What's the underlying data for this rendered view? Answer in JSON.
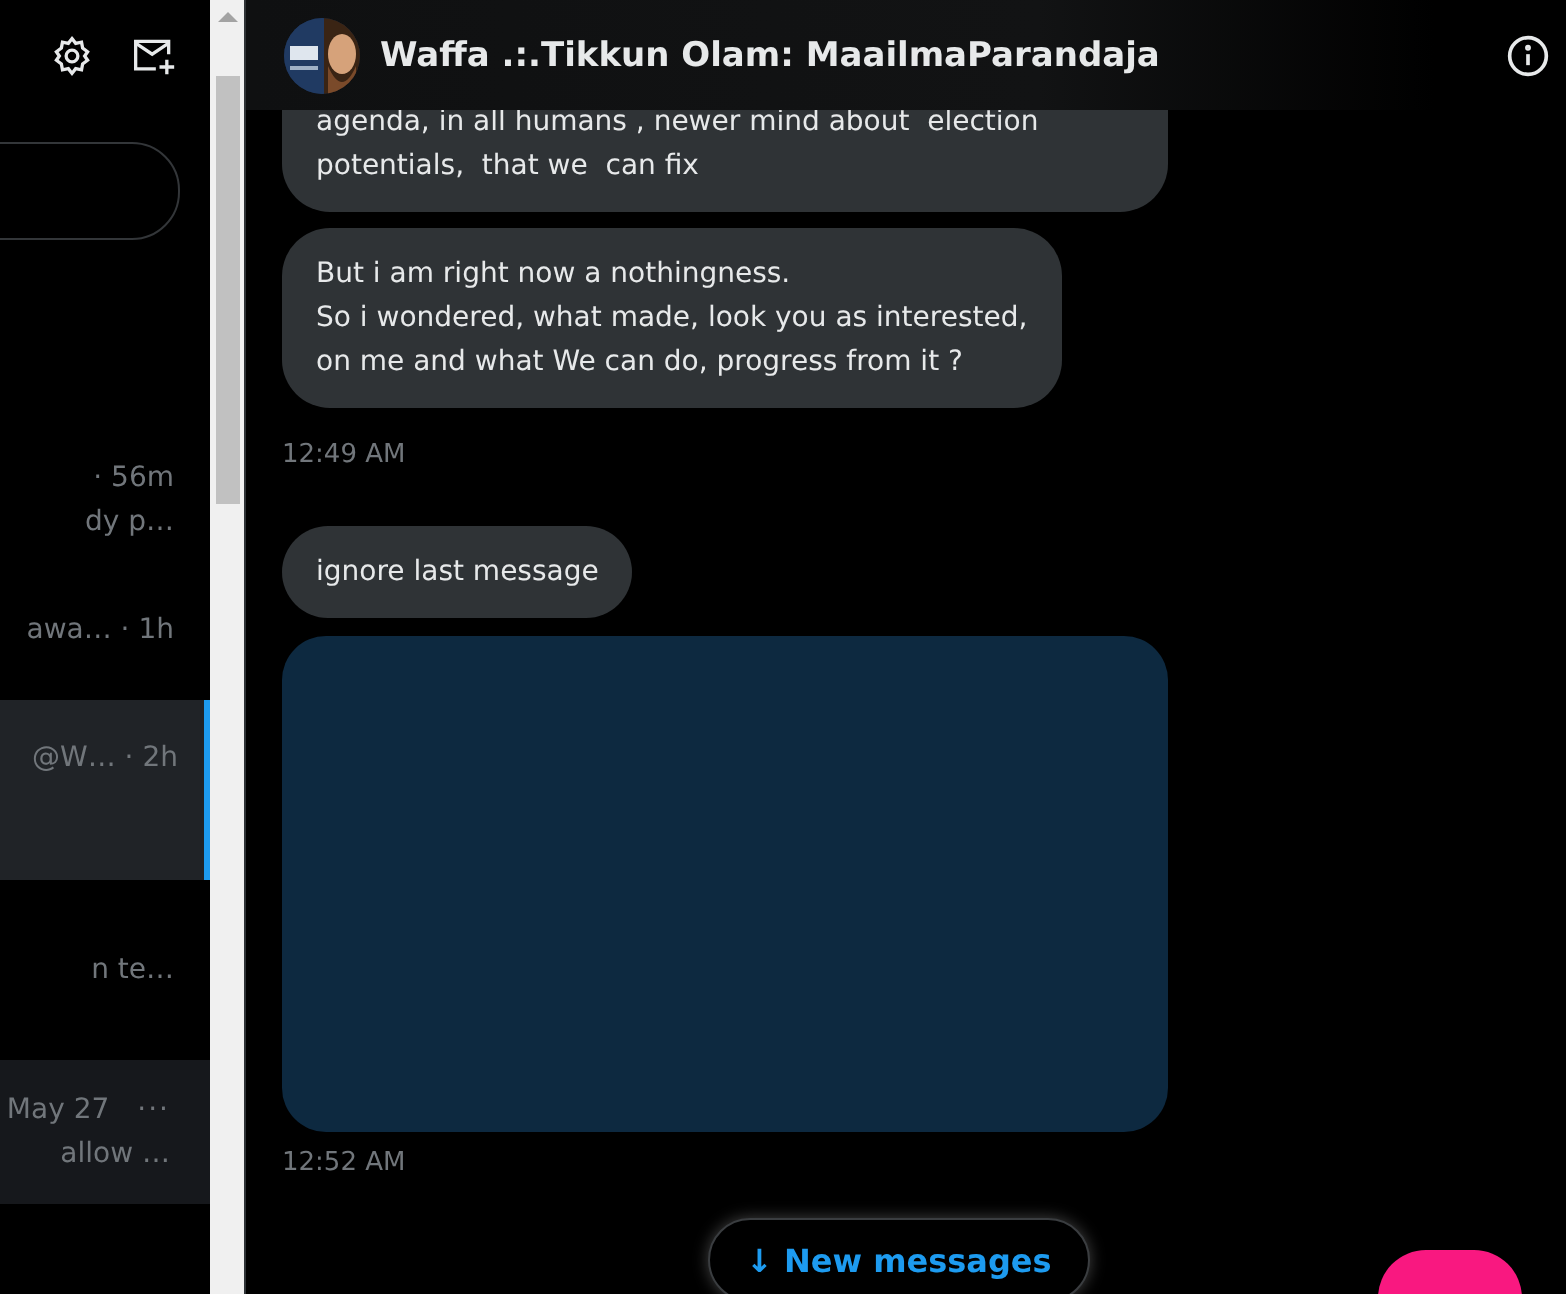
{
  "sidebar": {
    "conversations": [
      {
        "line_1": "· 56m",
        "line_2": "dy p…",
        "selected": false
      },
      {
        "line_1": "awa… · 1h",
        "selected": false
      },
      {
        "line_1": "@W… · 2h",
        "selected": true
      },
      {
        "line_2": "n te…",
        "selected": false
      },
      {
        "line_1": "May 27",
        "line_2": "allow …",
        "selected": false,
        "more": "···"
      }
    ]
  },
  "chat": {
    "title": "Waffa .:.Tikkun Olam: MaailmaParandaja",
    "messages": [
      {
        "kind": "text",
        "text": "agenda, in all humans , newer mind about  election\npotentials,  that we  can fix"
      },
      {
        "kind": "text",
        "text": "But i am right now a nothingness.\nSo i wondered, what made, look you as interested,\non me and what We can do, progress from it ?",
        "time": "12:49 AM"
      },
      {
        "kind": "text",
        "text": "ignore last message"
      },
      {
        "kind": "media",
        "time": "12:52 AM"
      }
    ],
    "new_messages": "↓ New messages"
  }
}
